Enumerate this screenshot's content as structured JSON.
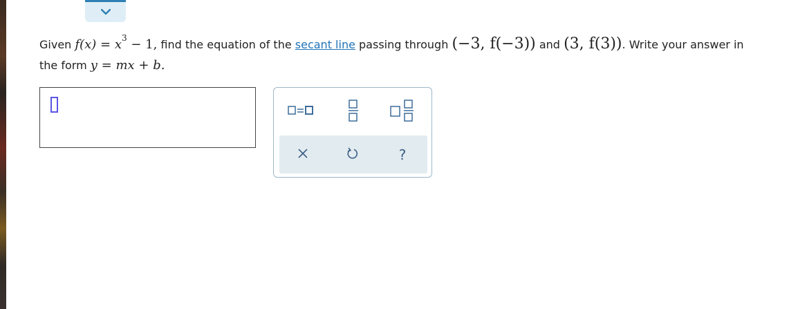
{
  "question": {
    "given": "Given",
    "fx_lhs": "f(x)",
    "equals": "=",
    "x_base": "x",
    "x_exp": "3",
    "minus_one": "− 1,",
    "find_text": "find the equation of the",
    "secant_link": "secant line",
    "passing_text": "passing through",
    "point1": "(−3, f(−3))",
    "and_text": "and",
    "point2": "(3, f(3))",
    "write_text": ". Write your answer in",
    "form_prefix": "the form",
    "form_eq": "y = mx + b."
  },
  "answer": {
    "value": ""
  },
  "palette": {
    "tools": [
      "equation-template",
      "fraction-template",
      "mixed-number-template"
    ],
    "actions": {
      "clear": "×",
      "undo": "↺",
      "help": "?"
    }
  },
  "colors": {
    "accent": "#2f7fb5",
    "link": "#1f73b7",
    "cursor": "#5b55e6",
    "tool_icon": "#3c6d9b",
    "actions_bg": "#e2ebef"
  }
}
